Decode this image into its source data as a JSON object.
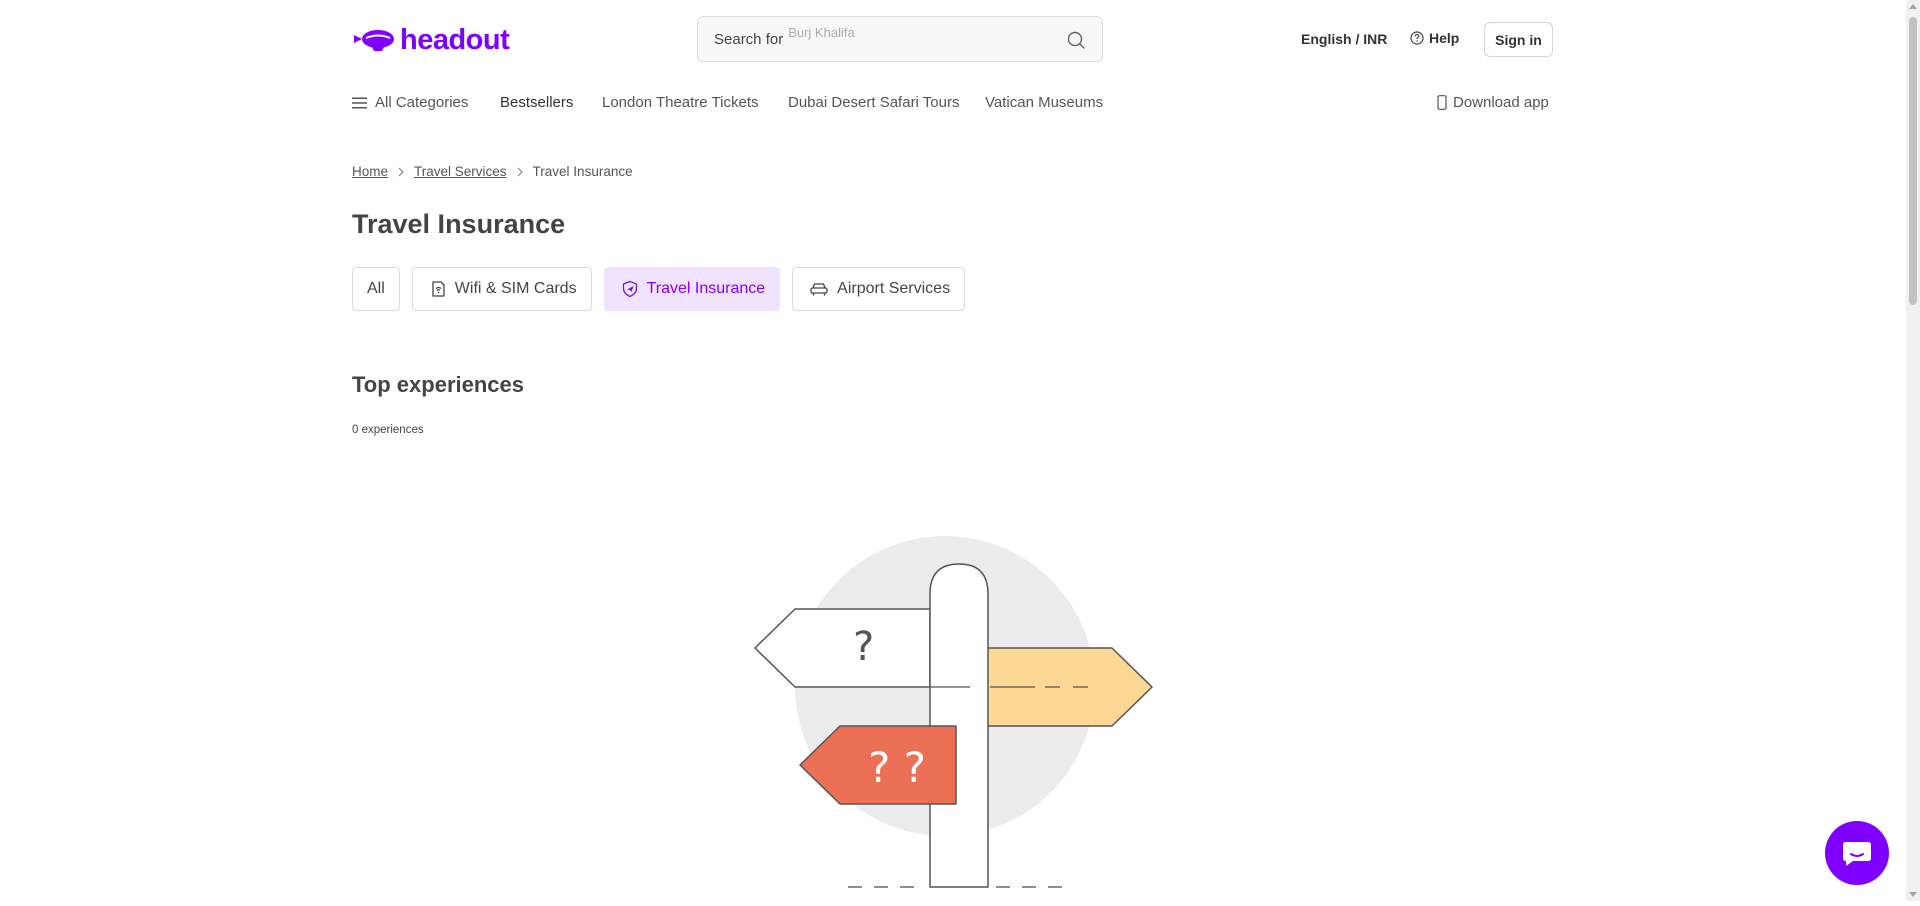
{
  "header": {
    "logo_text": "headout",
    "search": {
      "prefix": "Search for",
      "rolling_suggestion": "Burj Khalifa"
    },
    "language_currency": "English / INR",
    "help_label": "Help",
    "signin_label": "Sign in"
  },
  "nav": {
    "all_categories": "All Categories",
    "items": [
      "Bestsellers",
      "London Theatre Tickets",
      "Dubai Desert Safari Tours",
      "Vatican Museums"
    ],
    "download_app": "Download app"
  },
  "breadcrumb": {
    "home": "Home",
    "parent": "Travel Services",
    "current": "Travel Insurance"
  },
  "page_title": "Travel Insurance",
  "chips": [
    {
      "label": "All",
      "icon": "",
      "active": false
    },
    {
      "label": "Wifi & SIM Cards",
      "icon": "sim-card-icon",
      "active": false
    },
    {
      "label": "Travel Insurance",
      "icon": "shield-plane-icon",
      "active": true
    },
    {
      "label": "Airport Services",
      "icon": "car-icon",
      "active": false
    }
  ],
  "experiences": {
    "title": "Top experiences",
    "count_label": "0 experiences"
  },
  "illustration": {
    "left_sign": "?",
    "bottom_sign": "? ?",
    "right_sign": "— —"
  },
  "colors": {
    "brand": "#8000ff",
    "chip_active_bg": "#f0e3ff",
    "sign_red": "#eb7055",
    "sign_yellow": "#fdd794",
    "circle_bg": "#ececec"
  }
}
